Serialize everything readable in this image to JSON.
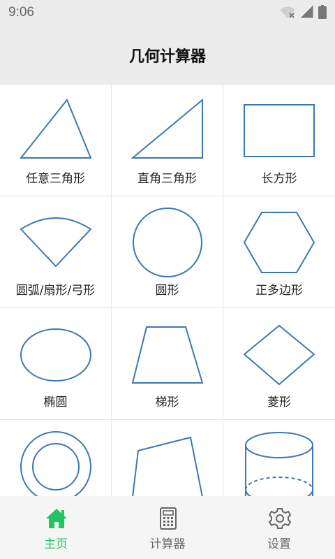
{
  "status_bar": {
    "time": "9:06",
    "icons": [
      "wifi-off-icon",
      "signal-icon",
      "battery-icon"
    ]
  },
  "app_bar": {
    "title": "几何计算器"
  },
  "shapes": [
    {
      "label": "任意三角形",
      "icon": "triangle-icon"
    },
    {
      "label": "直角三角形",
      "icon": "right-triangle-icon"
    },
    {
      "label": "长方形",
      "icon": "rectangle-icon"
    },
    {
      "label": "圆弧/扇形/弓形",
      "icon": "sector-icon"
    },
    {
      "label": "圆形",
      "icon": "circle-icon"
    },
    {
      "label": "正多边形",
      "icon": "hexagon-icon"
    },
    {
      "label": "椭圆",
      "icon": "ellipse-icon"
    },
    {
      "label": "梯形",
      "icon": "trapezoid-icon"
    },
    {
      "label": "菱形",
      "icon": "rhombus-icon"
    },
    {
      "label": "",
      "icon": "annulus-icon"
    },
    {
      "label": "",
      "icon": "quadrilateral-icon"
    },
    {
      "label": "",
      "icon": "cylinder-icon"
    }
  ],
  "tab_bar": {
    "tabs": [
      {
        "label": "主页",
        "icon": "home-icon",
        "active": true
      },
      {
        "label": "计算器",
        "icon": "calculator-icon",
        "active": false
      },
      {
        "label": "设置",
        "icon": "gear-icon",
        "active": false
      }
    ]
  },
  "colors": {
    "shape_stroke": "#3a78b5",
    "active_tab": "#22c55e",
    "inactive_tab": "#666666",
    "header_bg": "#ececec"
  }
}
